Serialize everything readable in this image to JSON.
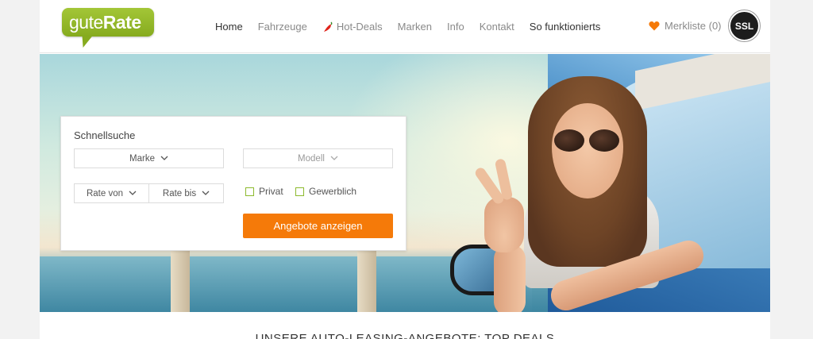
{
  "brand": {
    "logo_light": "gute",
    "logo_bold": "Rate",
    "brand_color": "#8fb42a"
  },
  "nav": {
    "items": [
      {
        "label": "Home",
        "icon": null
      },
      {
        "label": "Fahrzeuge",
        "icon": null
      },
      {
        "label": "Hot-Deals",
        "icon": "chili-icon"
      },
      {
        "label": "Marken",
        "icon": null
      },
      {
        "label": "Info",
        "icon": null
      },
      {
        "label": "Kontakt",
        "icon": null
      },
      {
        "label": "So funktionierts",
        "icon": null
      }
    ],
    "active": "Home"
  },
  "wishlist": {
    "label": "Merkliste (0)",
    "icon": "heart-icon",
    "icon_color": "#f57a09"
  },
  "ssl_badge": {
    "label": "SSL"
  },
  "search": {
    "title": "Schnellsuche",
    "brand_select": "Marke",
    "model_select": "Modell",
    "rate_from": "Rate von",
    "rate_to": "Rate bis",
    "private_label": "Privat",
    "business_label": "Gewerblich",
    "submit_label": "Angebote anzeigen",
    "accent_color": "#f57a09"
  },
  "section": {
    "title": "UNSERE AUTO-LEASING-ANGEBOTE: TOP DEALS"
  }
}
